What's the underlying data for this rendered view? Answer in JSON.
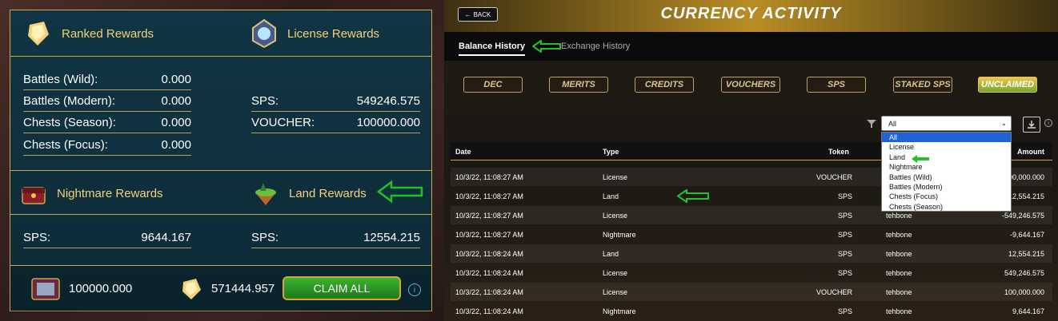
{
  "rewards": {
    "ranked": {
      "title": "Ranked Rewards",
      "rows": [
        {
          "label": "Battles (Wild):",
          "value": "0.000"
        },
        {
          "label": "Battles (Modern):",
          "value": "0.000"
        },
        {
          "label": "Chests (Season):",
          "value": "0.000"
        },
        {
          "label": "Chests (Focus):",
          "value": "0.000"
        }
      ]
    },
    "license": {
      "title": "License Rewards",
      "rows": [
        {
          "label": "SPS:",
          "value": "549246.575"
        },
        {
          "label": "VOUCHER:",
          "value": "100000.000"
        }
      ]
    },
    "nightmare": {
      "title": "Nightmare Rewards",
      "rows": [
        {
          "label": "SPS:",
          "value": "9644.167"
        }
      ]
    },
    "land": {
      "title": "Land Rewards",
      "rows": [
        {
          "label": "SPS:",
          "value": "12554.215"
        }
      ]
    },
    "footer": {
      "voucher_total": "100000.000",
      "sps_total": "571444.957",
      "claim_label": "CLAIM ALL"
    }
  },
  "activity": {
    "back_label": "BACK",
    "title": "CURRENCY ACTIVITY",
    "tabs": [
      "Balance History",
      "Exchange History"
    ],
    "currencies": [
      "DEC",
      "MERITS",
      "CREDITS",
      "VOUCHERS",
      "SPS",
      "STAKED SPS",
      "UNCLAIMED"
    ],
    "active_currency": "UNCLAIMED",
    "filter": {
      "selected": "All",
      "options": [
        "All",
        "License",
        "Land",
        "Nightmare",
        "Battles (Wild)",
        "Battles (Modern)",
        "Chests (Focus)",
        "Chests (Season)"
      ]
    },
    "columns": [
      "Date",
      "Type",
      "Token",
      "Amount"
    ],
    "rows": [
      {
        "date": "10/3/22, 11:08:27 AM",
        "type": "License",
        "token": "VOUCHER",
        "player": "",
        "amount": "-100,000.000"
      },
      {
        "date": "10/3/22, 11:08:27 AM",
        "type": "Land",
        "token": "SPS",
        "player": "",
        "amount": "-12,554.215"
      },
      {
        "date": "10/3/22, 11:08:27 AM",
        "type": "License",
        "token": "SPS",
        "player": "tehbone",
        "amount": "-549,246.575"
      },
      {
        "date": "10/3/22, 11:08:27 AM",
        "type": "Nightmare",
        "token": "SPS",
        "player": "tehbone",
        "amount": "-9,644.167"
      },
      {
        "date": "10/3/22, 11:08:24 AM",
        "type": "Land",
        "token": "SPS",
        "player": "tehbone",
        "amount": "12,554.215"
      },
      {
        "date": "10/3/22, 11:08:24 AM",
        "type": "License",
        "token": "SPS",
        "player": "tehbone",
        "amount": "549,246.575"
      },
      {
        "date": "10/3/22, 11:08:24 AM",
        "type": "License",
        "token": "VOUCHER",
        "player": "tehbone",
        "amount": "100,000.000"
      },
      {
        "date": "10/3/22, 11:08:24 AM",
        "type": "Nightmare",
        "token": "SPS",
        "player": "tehbone",
        "amount": "9,644.167"
      }
    ]
  }
}
